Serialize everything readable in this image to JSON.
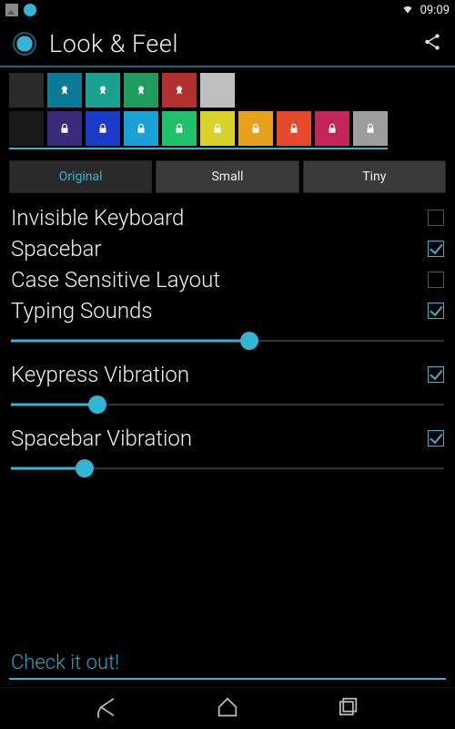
{
  "status": {
    "time": "09:09"
  },
  "appbar": {
    "title": "Look & Feel"
  },
  "themes_row1": [
    {
      "color": "#2a2a2a",
      "badge": "none"
    },
    {
      "color": "#0a7a96",
      "badge": "award"
    },
    {
      "color": "#1aa18f",
      "badge": "award"
    },
    {
      "color": "#1f9b5b",
      "badge": "award"
    },
    {
      "color": "#b33030",
      "badge": "award"
    },
    {
      "color": "#bfbfbf",
      "badge": "none"
    }
  ],
  "themes_row2": [
    {
      "color": "#1a1a1a",
      "badge": "none"
    },
    {
      "color": "#3a2b7a",
      "badge": "lock"
    },
    {
      "color": "#1b3cc9",
      "badge": "lock"
    },
    {
      "color": "#1aa1d6",
      "badge": "lock"
    },
    {
      "color": "#20c06b",
      "badge": "lock"
    },
    {
      "color": "#d9d22a",
      "badge": "lock"
    },
    {
      "color": "#e6a21e",
      "badge": "lock"
    },
    {
      "color": "#e44a2a",
      "badge": "lock"
    },
    {
      "color": "#c3265a",
      "badge": "lock"
    },
    {
      "color": "#9e9e9e",
      "badge": "lock"
    }
  ],
  "tabs": {
    "items": [
      {
        "label": "Original",
        "active": true
      },
      {
        "label": "Small",
        "active": false
      },
      {
        "label": "Tiny",
        "active": false
      }
    ]
  },
  "settings": {
    "invisible_keyboard": {
      "label": "Invisible Keyboard",
      "checked": false
    },
    "spacebar": {
      "label": "Spacebar",
      "checked": true
    },
    "case_sensitive": {
      "label": "Case Sensitive Layout",
      "checked": false
    },
    "typing_sounds": {
      "label": "Typing Sounds",
      "checked": true,
      "slider": 55
    },
    "keypress_vibration": {
      "label": "Keypress Vibration",
      "checked": true,
      "slider": 20
    },
    "spacebar_vibration": {
      "label": "Spacebar Vibration",
      "checked": true,
      "slider": 17
    }
  },
  "input": {
    "placeholder": "Check it out!"
  },
  "accent": "#33b5d5"
}
